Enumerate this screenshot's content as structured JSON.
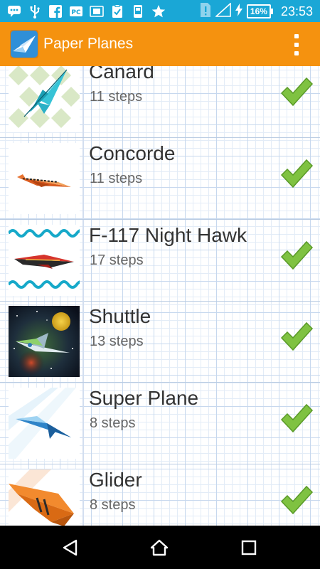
{
  "status_bar": {
    "icons": [
      "chat-bubble-icon",
      "usb-icon",
      "facebook-icon",
      "pc-icon",
      "sim-card-icon",
      "clipboard-check-icon",
      "phone-icon",
      "star-icon",
      "sim-alert-icon",
      "signal-icon",
      "charging-icon"
    ],
    "battery": "16%",
    "time": "23:53"
  },
  "app_bar": {
    "title": "Paper Planes",
    "color": "#f5920f"
  },
  "planes": [
    {
      "name": "Canard",
      "steps": "11 steps",
      "icon": "canard-thumbnail"
    },
    {
      "name": "Concorde",
      "steps": "11 steps",
      "icon": "concorde-thumbnail"
    },
    {
      "name": "F-117 Night Hawk",
      "steps": "17 steps",
      "icon": "f117-thumbnail"
    },
    {
      "name": "Shuttle",
      "steps": "13 steps",
      "icon": "shuttle-thumbnail"
    },
    {
      "name": "Super Plane",
      "steps": "8 steps",
      "icon": "super-plane-thumbnail"
    },
    {
      "name": "Glider",
      "steps": "8 steps",
      "icon": "glider-thumbnail"
    }
  ],
  "nav_bar": {
    "buttons": [
      "back-icon",
      "home-icon",
      "recents-icon"
    ]
  }
}
